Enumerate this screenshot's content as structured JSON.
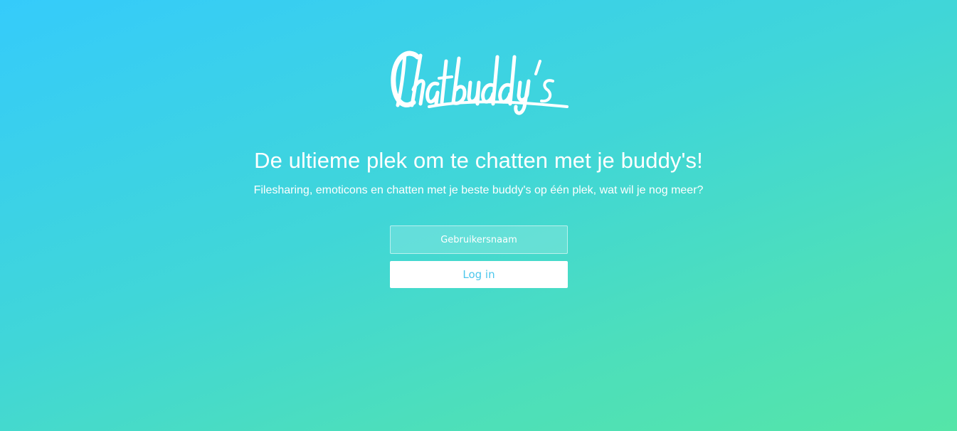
{
  "brand": {
    "logo_text": "Chatbuddy's"
  },
  "hero": {
    "headline": "De ultieme plek om te chatten met je buddy's!",
    "subline": "Filesharing, emoticons en chatten met je beste buddy's op één plek, wat wil je nog meer?"
  },
  "login_form": {
    "username_placeholder": "Gebruikersnaam",
    "username_value": "",
    "login_label": "Log in"
  },
  "colors": {
    "gradient_start": "#35cbfb",
    "gradient_end": "#55e5a8",
    "button_text": "#4cc6ec",
    "text": "#ffffff"
  }
}
